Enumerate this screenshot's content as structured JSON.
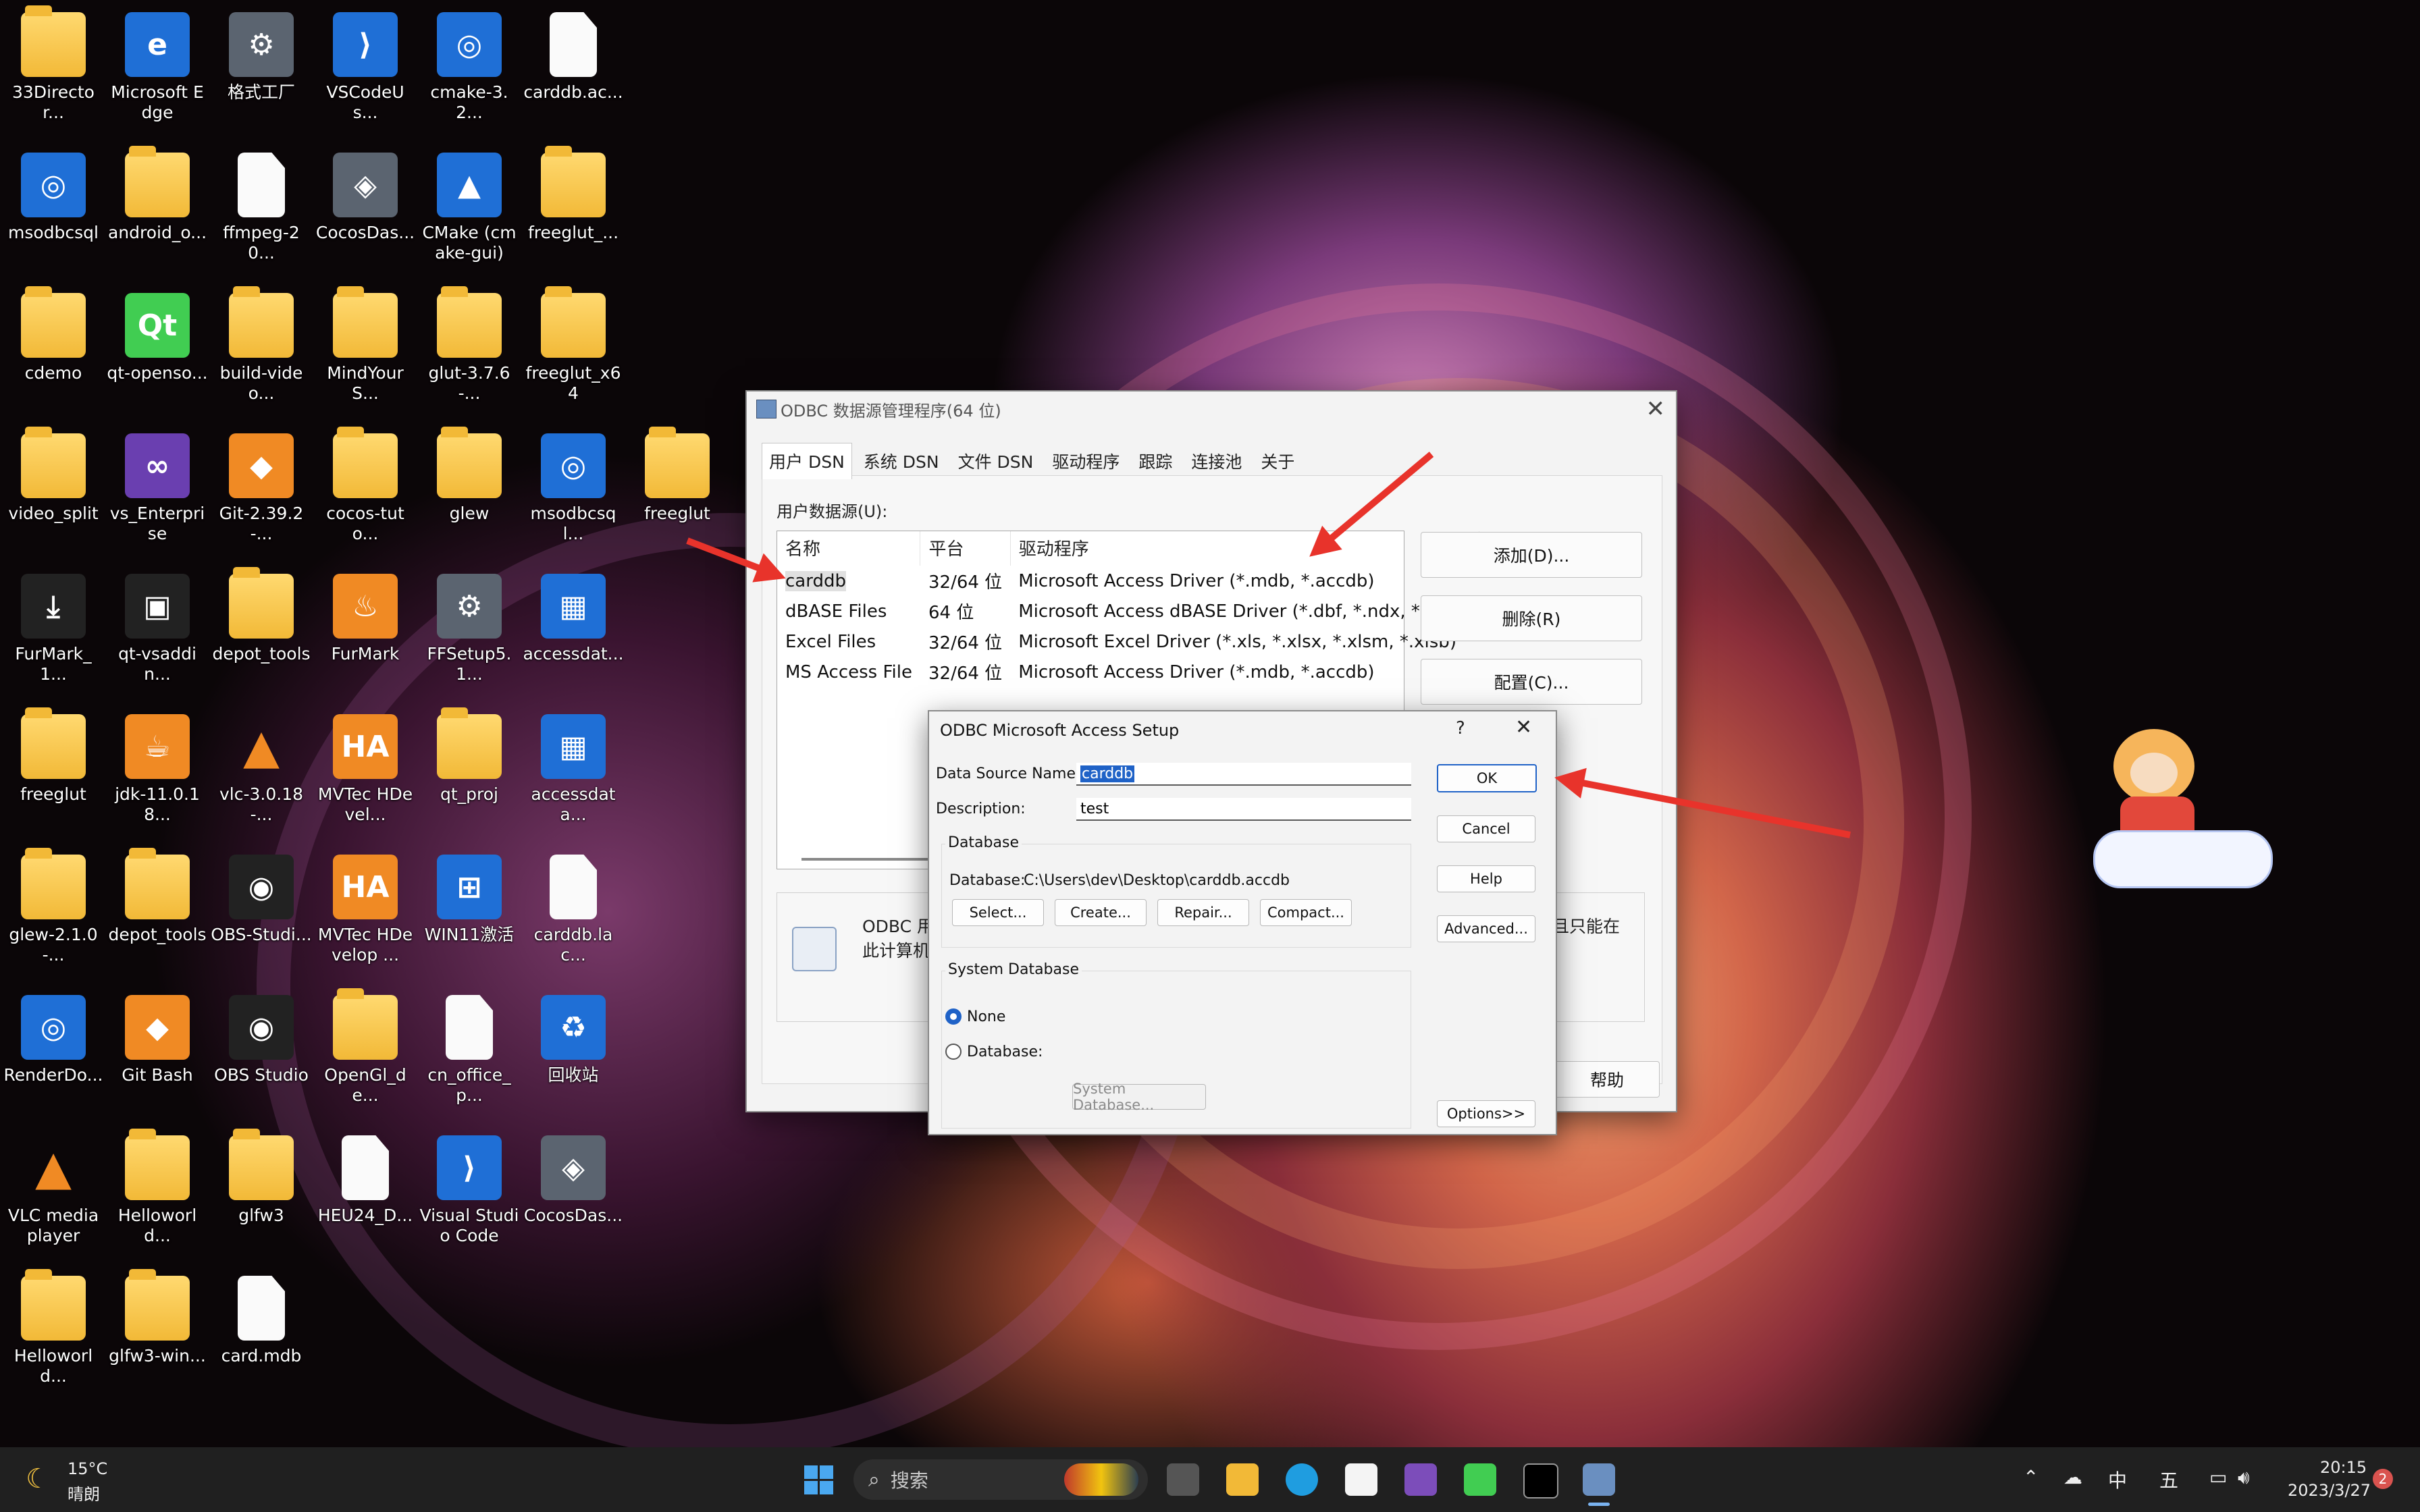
{
  "desktop": {
    "icons": [
      {
        "label": "33Director...",
        "kind": "folder"
      },
      {
        "label": "Microsoft Edge",
        "kind": "edge"
      },
      {
        "label": "格式工厂",
        "kind": "app"
      },
      {
        "label": "VSCodeUs...",
        "kind": "vscode"
      },
      {
        "label": "cmake-3.2...",
        "kind": "disc"
      },
      {
        "label": "carddb.ac...",
        "kind": "file"
      },
      {
        "label": "msodbcsql",
        "kind": "disc"
      },
      {
        "label": "android_o...",
        "kind": "folder"
      },
      {
        "label": "ffmpeg-20...",
        "kind": "file"
      },
      {
        "label": "CocosDas...",
        "kind": "cocos"
      },
      {
        "label": "CMake (cmake-gui)",
        "kind": "cmake"
      },
      {
        "label": "freeglut_...",
        "kind": "folder"
      },
      {
        "label": "cdemo",
        "kind": "folder"
      },
      {
        "label": "qt-openso...",
        "kind": "qt"
      },
      {
        "label": "build-video...",
        "kind": "folder"
      },
      {
        "label": "MindYourS...",
        "kind": "folder"
      },
      {
        "label": "glut-3.7.6-...",
        "kind": "folder"
      },
      {
        "label": "freeglut_x64",
        "kind": "folder"
      },
      {
        "label": "video_split",
        "kind": "folder"
      },
      {
        "label": "vs_Enterprise",
        "kind": "vs"
      },
      {
        "label": "Git-2.39.2-...",
        "kind": "git"
      },
      {
        "label": "cocos-tuto...",
        "kind": "folder"
      },
      {
        "label": "glew",
        "kind": "folder"
      },
      {
        "label": "msodbcsql...",
        "kind": "disc"
      },
      {
        "label": "freeglut",
        "kind": "folder"
      },
      {
        "label": "FurMark_1...",
        "kind": "download"
      },
      {
        "label": "qt-vsaddin...",
        "kind": "qtbox"
      },
      {
        "label": "depot_tools",
        "kind": "folder"
      },
      {
        "label": "FurMark",
        "kind": "furmark"
      },
      {
        "label": "FFSetup5.1...",
        "kind": "app"
      },
      {
        "label": "accessdat...",
        "kind": "setup"
      },
      {
        "label": "freeglut",
        "kind": "folder"
      },
      {
        "label": "jdk-11.0.18...",
        "kind": "java"
      },
      {
        "label": "vlc-3.0.18-...",
        "kind": "vlc"
      },
      {
        "label": "MVTec HDevel...",
        "kind": "ha"
      },
      {
        "label": "qt_proj",
        "kind": "folder"
      },
      {
        "label": "accessdata...",
        "kind": "setup"
      },
      {
        "label": "glew-2.1.0-...",
        "kind": "folder"
      },
      {
        "label": "depot_tools",
        "kind": "folder"
      },
      {
        "label": "OBS-Studi...",
        "kind": "obs"
      },
      {
        "label": "MVTec HDevelop ...",
        "kind": "ha"
      },
      {
        "label": "WIN11激活",
        "kind": "win"
      },
      {
        "label": "carddb.lac...",
        "kind": "file"
      },
      {
        "label": "RenderDo...",
        "kind": "disc"
      },
      {
        "label": "Git Bash",
        "kind": "git"
      },
      {
        "label": "OBS Studio",
        "kind": "obs"
      },
      {
        "label": "OpenGl_de...",
        "kind": "folder"
      },
      {
        "label": "cn_office_p...",
        "kind": "file"
      },
      {
        "label": "回收站",
        "kind": "recycle"
      },
      {
        "label": "VLC media player",
        "kind": "vlc"
      },
      {
        "label": "Helloworld...",
        "kind": "folder"
      },
      {
        "label": "glfw3",
        "kind": "folder"
      },
      {
        "label": "HEU24_D...",
        "kind": "file"
      },
      {
        "label": "Visual Studio Code",
        "kind": "vscode"
      },
      {
        "label": "CocosDas...",
        "kind": "cocos"
      },
      {
        "label": "Helloworld...",
        "kind": "folder"
      },
      {
        "label": "glfw3-win...",
        "kind": "folder"
      },
      {
        "label": "card.mdb",
        "kind": "file"
      }
    ]
  },
  "odbc": {
    "title": "ODBC 数据源管理程序(64 位)",
    "tabs": [
      "用户 DSN",
      "系统 DSN",
      "文件 DSN",
      "驱动程序",
      "跟踪",
      "连接池",
      "关于"
    ],
    "section_label": "用户数据源(U):",
    "columns": [
      "名称",
      "平台",
      "驱动程序"
    ],
    "rows": [
      {
        "name": "carddb",
        "platform": "32/64 位",
        "driver": "Microsoft Access Driver (*.mdb, *.accdb)"
      },
      {
        "name": "dBASE Files",
        "platform": "64 位",
        "driver": "Microsoft Access dBASE Driver (*.dbf, *.ndx, *.mdx)"
      },
      {
        "name": "Excel Files",
        "platform": "32/64 位",
        "driver": "Microsoft Excel Driver (*.xls, *.xlsx, *.xlsm, *.xlsb)"
      },
      {
        "name": "MS Access File",
        "platform": "32/64 位",
        "driver": "Microsoft Access Driver (*.mdb, *.accdb)"
      }
    ],
    "buttons": {
      "add": "添加(D)...",
      "remove": "删除(R)",
      "configure": "配置(C)...",
      "help": "帮助"
    },
    "info_text_1": "ODBC 用",
    "info_text_2": "此计算机",
    "info_text_right": "且只能在"
  },
  "setup": {
    "title": "ODBC Microsoft Access Setup",
    "help_glyph": "?",
    "dsn_label": "Data Source Name:",
    "dsn_value": "carddb",
    "desc_label": "Description:",
    "desc_value": "test",
    "database_group": "Database",
    "database_label": "Database:",
    "database_path": "C:\\Users\\dev\\Desktop\\carddb.accdb",
    "btn_select": "Select...",
    "btn_create": "Create...",
    "btn_repair": "Repair...",
    "btn_compact": "Compact...",
    "system_group": "System Database",
    "radio_none": "None",
    "radio_database": "Database:",
    "btn_system_db": "System Database...",
    "btn_ok": "OK",
    "btn_cancel": "Cancel",
    "btn_help": "Help",
    "btn_advanced": "Advanced...",
    "btn_options": "Options>>"
  },
  "taskbar": {
    "weather_temp": "15°C",
    "weather_desc": "晴朗",
    "search_placeholder": "搜索",
    "tray_ime": "中",
    "tray_ime2": "五",
    "time": "20:15",
    "date": "2023/3/27",
    "notification_count": "2"
  },
  "colors": {
    "accent": "#1f62c7",
    "arrow": "#e8332b",
    "taskbar": "#202020"
  }
}
